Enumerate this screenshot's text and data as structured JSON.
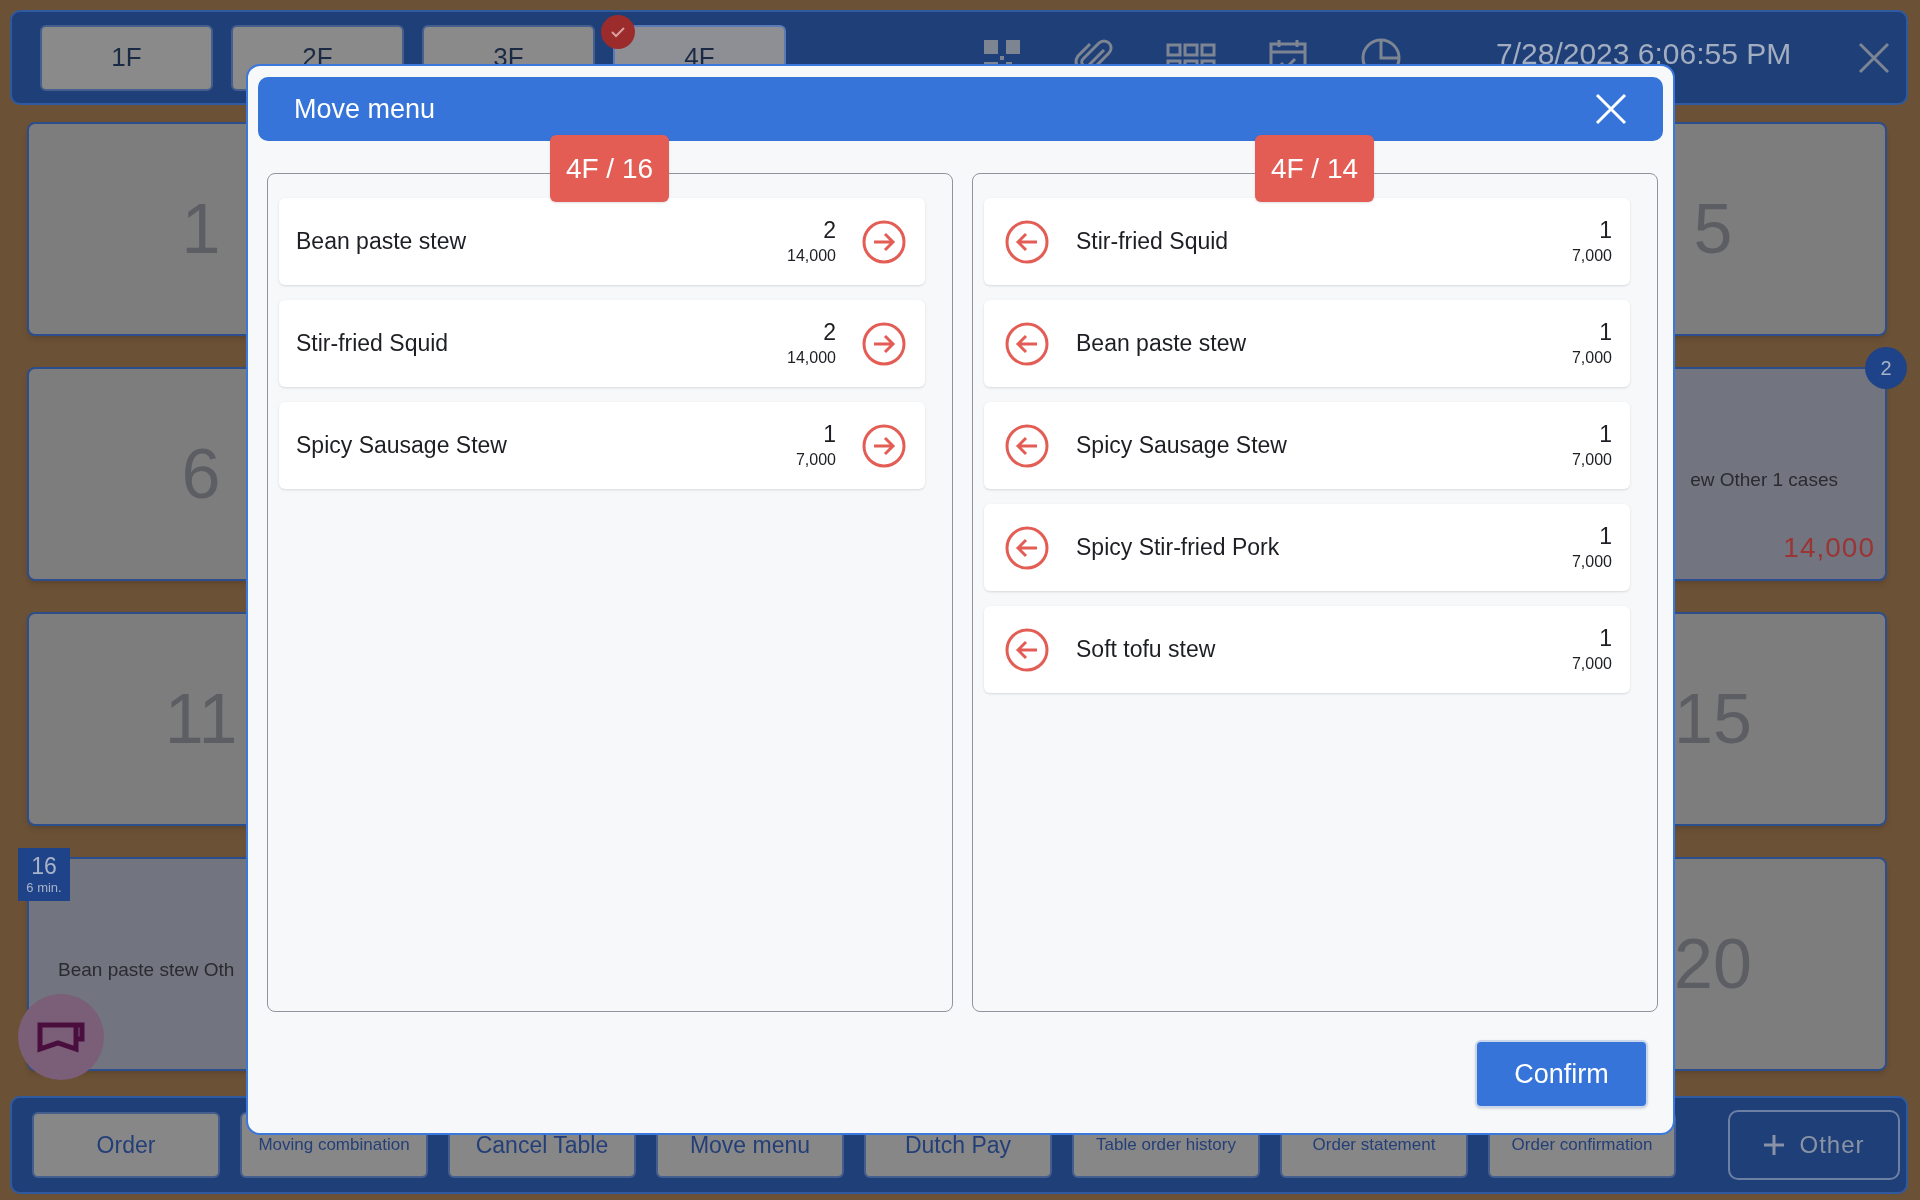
{
  "floor_tabs": [
    {
      "label": "1F",
      "selected": false
    },
    {
      "label": "2F",
      "selected": false
    },
    {
      "label": "3F",
      "selected": false
    },
    {
      "label": "4F",
      "selected": true
    }
  ],
  "datetime": "7/28/2023 6:06:55 PM",
  "table_rows": [
    {
      "left": {
        "number": "1"
      },
      "right": {
        "number": "5"
      }
    },
    {
      "left": {
        "number": "6"
      },
      "right": {
        "guests": "2",
        "summary": "ew Other 1 cases",
        "total": "14,000"
      }
    },
    {
      "left": {
        "number": "11"
      },
      "right": {
        "number": "15"
      }
    },
    {
      "left": {
        "tag_number": "16",
        "minutes": "6 min.",
        "summary": "Bean paste stew Oth"
      },
      "right": {
        "number": "20"
      }
    }
  ],
  "actions": [
    {
      "label": "Order"
    },
    {
      "label": "Moving combination"
    },
    {
      "label": "Cancel Table"
    },
    {
      "label": "Move menu"
    },
    {
      "label": "Dutch Pay"
    },
    {
      "label": "Table order history"
    },
    {
      "label": "Order statement"
    },
    {
      "label": "Order confirmation"
    }
  ],
  "other_button": "Other",
  "dialog": {
    "title": "Move menu",
    "source": {
      "badge": "4F / 16",
      "items": [
        {
          "name": "Bean paste stew",
          "qty": "2",
          "price": "14,000"
        },
        {
          "name": "Stir-fried Squid",
          "qty": "2",
          "price": "14,000"
        },
        {
          "name": "Spicy Sausage Stew",
          "qty": "1",
          "price": "7,000"
        }
      ]
    },
    "target": {
      "badge": "4F / 14",
      "items": [
        {
          "name": "Stir-fried Squid",
          "qty": "1",
          "price": "7,000"
        },
        {
          "name": "Bean paste stew",
          "qty": "1",
          "price": "7,000"
        },
        {
          "name": "Spicy Sausage Stew",
          "qty": "1",
          "price": "7,000"
        },
        {
          "name": "Spicy Stir-fried Pork",
          "qty": "1",
          "price": "7,000"
        },
        {
          "name": "Soft tofu stew",
          "qty": "1",
          "price": "7,000"
        }
      ]
    },
    "confirm": "Confirm"
  }
}
